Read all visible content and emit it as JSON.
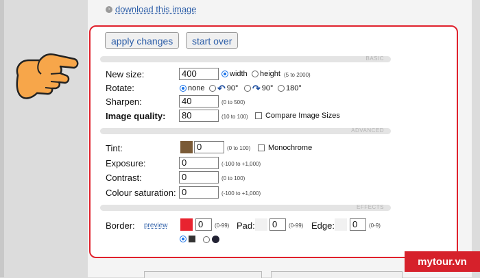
{
  "download": {
    "icon": "chevron-icon",
    "link_text": "download this image"
  },
  "buttons": {
    "apply": "apply changes",
    "start_over": "start over"
  },
  "sections": {
    "basic": "BASIC",
    "advanced": "ADVANCED",
    "effects": "EFFECTS"
  },
  "basic": {
    "new_size": {
      "label": "New size:",
      "value": "400",
      "opt_width": "width",
      "opt_height": "height",
      "range": "(5 to 2000)"
    },
    "rotate": {
      "label": "Rotate:",
      "opt_none": "none",
      "opt_ccw": "90°",
      "opt_cw": "90°",
      "opt_180": "180°"
    },
    "sharpen": {
      "label": "Sharpen:",
      "value": "40",
      "range": "(0 to 500)"
    },
    "quality": {
      "label": "Image quality:",
      "value": "80",
      "range": "(10 to 100)",
      "compare": "Compare Image Sizes"
    }
  },
  "advanced": {
    "tint": {
      "label": "Tint:",
      "value": "0",
      "range": "(0 to 100)",
      "monochrome": "Monochrome",
      "color": "#7a5a36"
    },
    "exposure": {
      "label": "Exposure:",
      "value": "0",
      "range": "(-100 to +1,000)"
    },
    "contrast": {
      "label": "Contrast:",
      "value": "0",
      "range": "(0 to 100)"
    },
    "saturation": {
      "label": "Colour saturation:",
      "value": "0",
      "range": "(-100 to +1,000)"
    }
  },
  "effects": {
    "border": {
      "label": "Border:",
      "preview": "preview",
      "value": "0",
      "range": "(0-99)",
      "color": "#e8232f"
    },
    "pad": {
      "label": "Pad:",
      "value": "0",
      "range": "(0-99)"
    },
    "edge": {
      "label": "Edge:",
      "value": "0",
      "range": "(0-9)"
    }
  },
  "brand": "mytour.vn",
  "colors": {
    "panel_border": "#e0212c",
    "link": "#2d5ea8",
    "accent": "#1a73e8"
  }
}
